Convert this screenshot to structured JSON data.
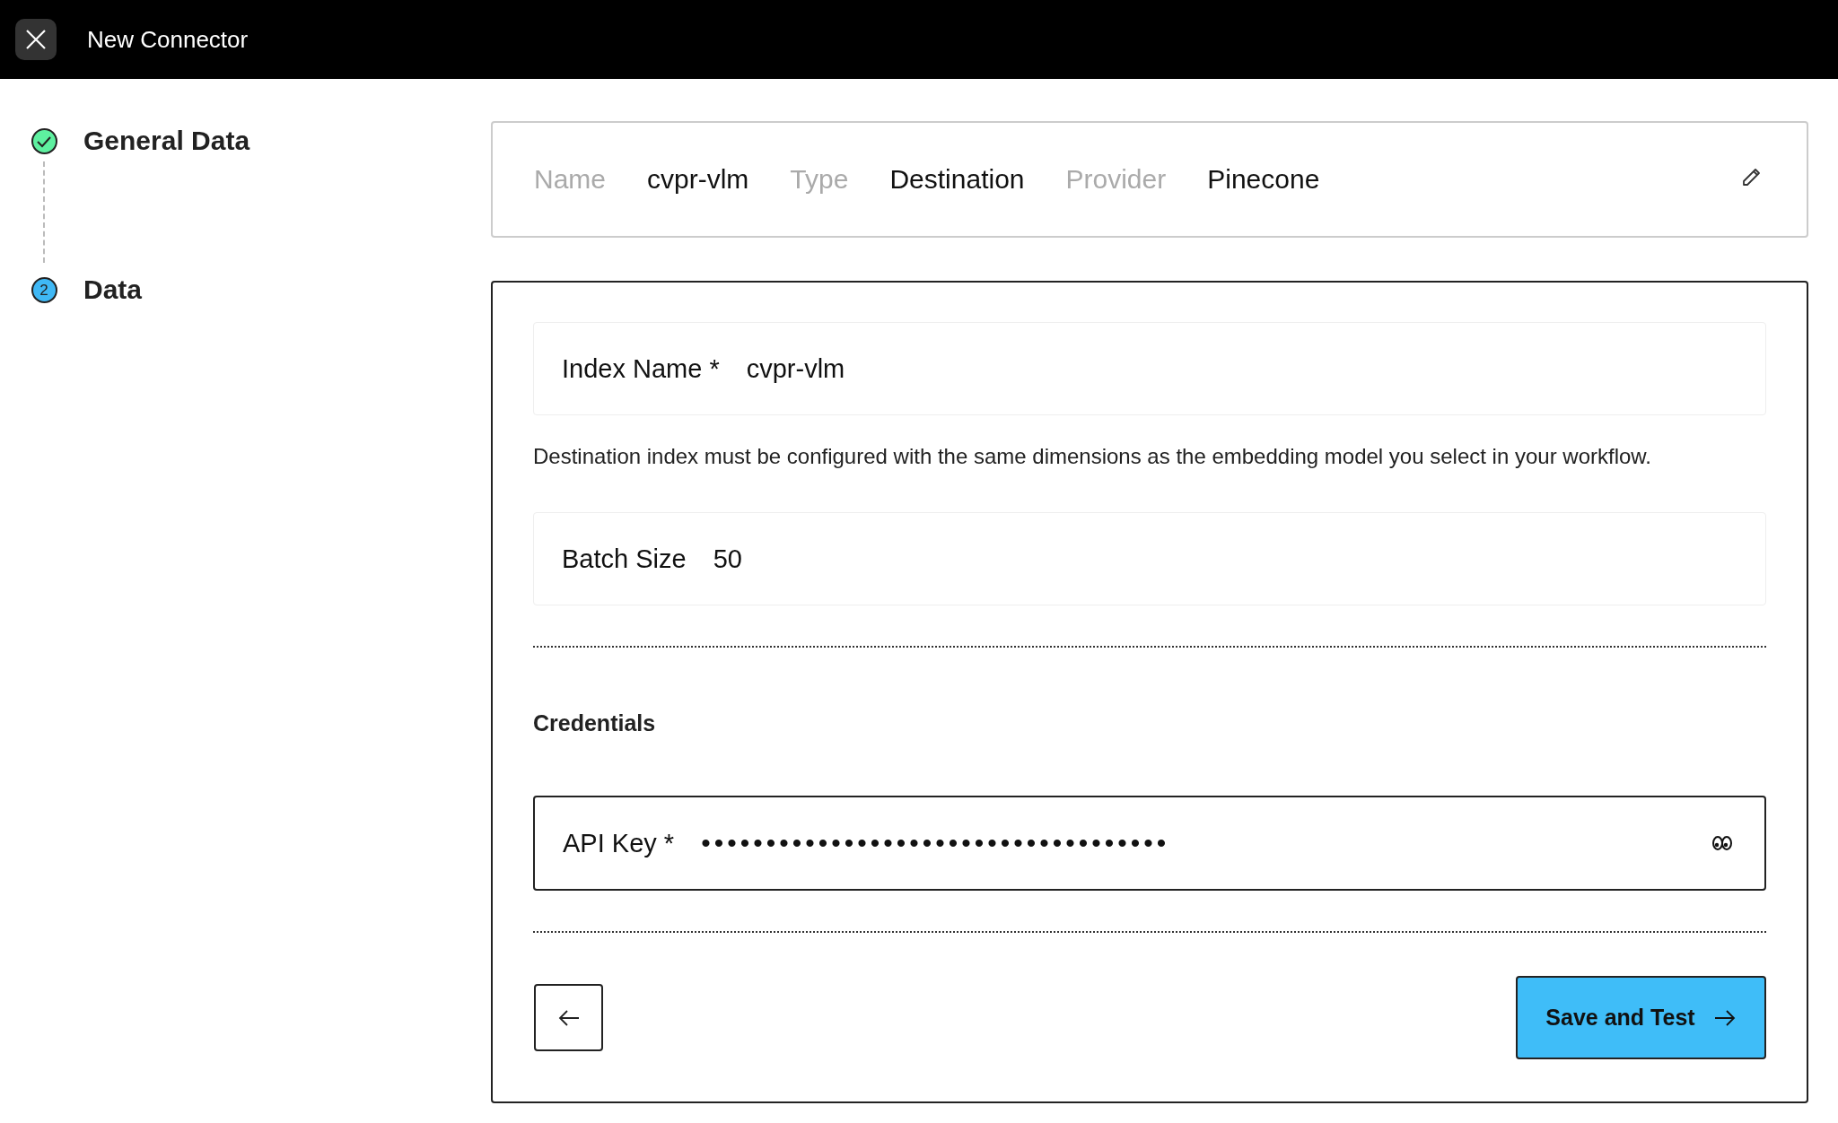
{
  "window": {
    "title": "New Connector"
  },
  "steps": [
    {
      "label": "General Data",
      "done": true
    },
    {
      "label": "Data",
      "number": "2",
      "done": false
    }
  ],
  "summary": [
    {
      "label": "Name",
      "value": "cvpr-vlm"
    },
    {
      "label": "Type",
      "value": "Destination"
    },
    {
      "label": "Provider",
      "value": "Pinecone"
    }
  ],
  "fields": [
    {
      "label": "Index Name *",
      "value": "cvpr-vlm",
      "help": "Destination index must be configured with the same dimensions as the embedding model you select in your workflow."
    },
    {
      "label": "Batch Size",
      "value": "50"
    }
  ],
  "credentials": {
    "title": "Credentials",
    "fields": [
      {
        "kind": "secret",
        "label": "API Key *",
        "value": "••••••••••••••••••••••••••••••••••••"
      }
    ]
  },
  "buttons": {
    "save": "Save and Test"
  }
}
